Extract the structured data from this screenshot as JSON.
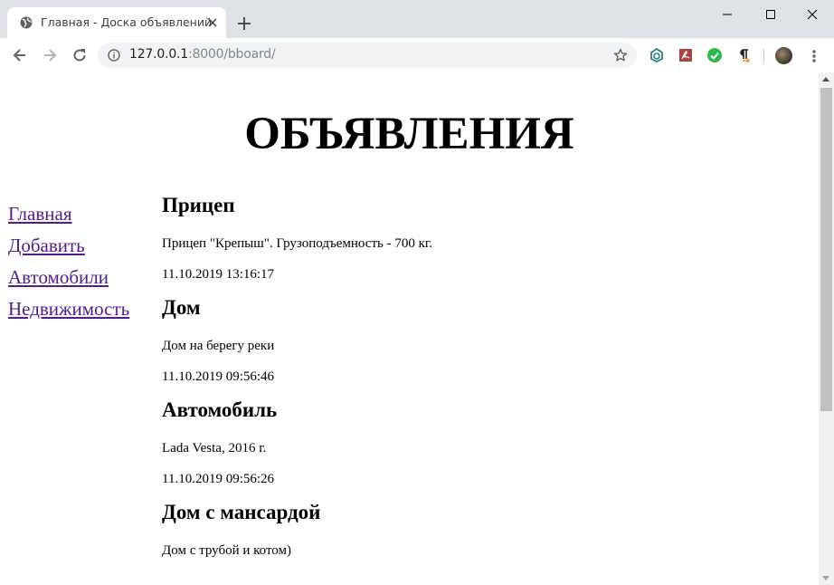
{
  "browser": {
    "tab_title": "Главная - Доска объявлений",
    "url_host": "127.0.0.1",
    "url_rest": ":8000/bboard/",
    "extensions": [
      "tampermonkey-icon",
      "pdf-icon",
      "checkmark-extension-icon",
      "paragraph-extension-icon"
    ]
  },
  "page": {
    "title": "ОБЪЯВЛЕНИЯ",
    "nav": [
      {
        "label": "Главная"
      },
      {
        "label": "Добавить"
      },
      {
        "label": "Автомобили"
      },
      {
        "label": "Недвижимость"
      }
    ],
    "ads": [
      {
        "title": "Прицеп",
        "content": "Прицеп \"Крепыш\". Грузоподъемность - 700 кг.",
        "published": "11.10.2019 13:16:17"
      },
      {
        "title": "Дом",
        "content": "Дом на берегу реки",
        "published": "11.10.2019 09:56:46"
      },
      {
        "title": "Автомобиль",
        "content": "Lada Vesta, 2016 г.",
        "published": "11.10.2019 09:56:26"
      },
      {
        "title": "Дом с мансардой",
        "content": "Дом с трубой и котом)",
        "published": ""
      }
    ]
  },
  "colors": {
    "chrome_bg": "#dee1e6",
    "visited_link": "#551a8b"
  }
}
